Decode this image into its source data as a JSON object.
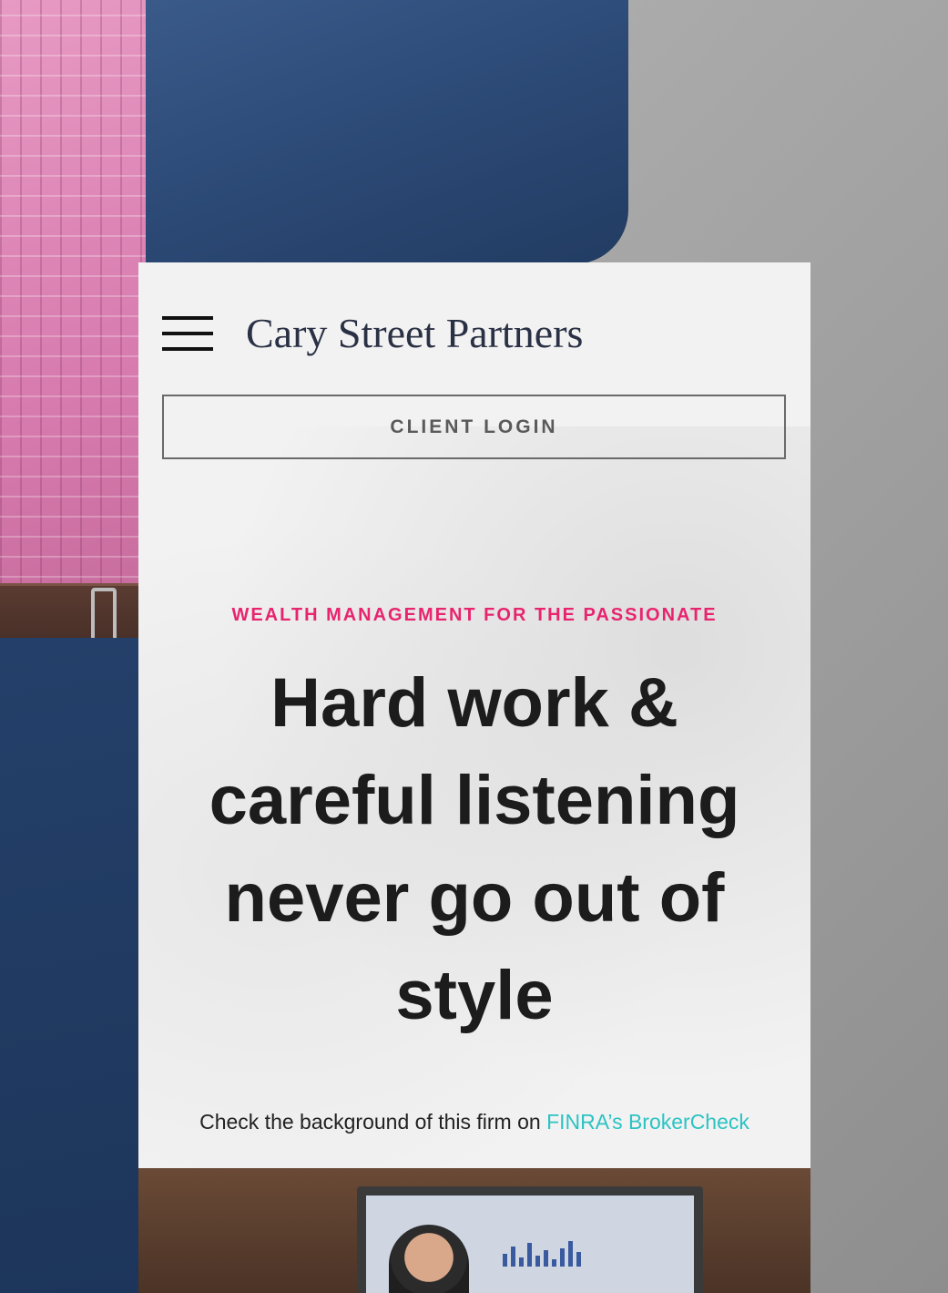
{
  "brand": {
    "logo_text": "Cary Street Partners"
  },
  "header": {
    "menu_icon": "hamburger-menu-icon"
  },
  "actions": {
    "client_login_label": "CLIENT LOGIN"
  },
  "hero": {
    "eyebrow": "WEALTH MANAGEMENT FOR THE PASSIONATE",
    "headline": "Hard work & careful listening never go out of style"
  },
  "disclosure": {
    "prefix": "Check the background of this firm on ",
    "link_text": "FINRA’s BrokerCheck"
  },
  "colors": {
    "accent_pink": "#e8246e",
    "link_teal": "#2cc3c3",
    "card_background": "#f2f2f2",
    "logo_navy": "#2b3145"
  }
}
